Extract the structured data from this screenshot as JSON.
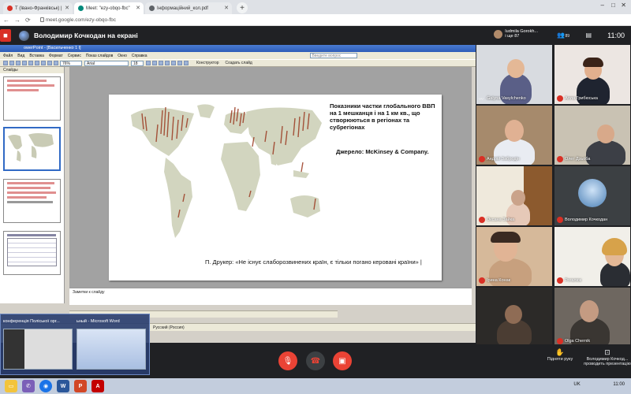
{
  "browser": {
    "tabs": [
      {
        "label": "T (Івано-Франківськ) |",
        "color": "#d93025"
      },
      {
        "label": "Meet: \"ezy-obqo-fbc\"",
        "color": "#00897b"
      },
      {
        "label": "Інформаційний_кол.pdf",
        "color": "#5f6368"
      }
    ],
    "new_tab": "+",
    "url": "meet.google.com/ezy-obqo-fbc",
    "window_controls": [
      "–",
      "□",
      "✕"
    ]
  },
  "meet": {
    "presenting_label": "Володимир Кочкодан на екрані",
    "host_chip_name": "ludmila Gorokh...",
    "host_chip_sub": "і ще 87",
    "people_count": "89",
    "clock": "11:00",
    "participants": [
      {
        "name": "Galyna Vasylchenko",
        "muted": false
      },
      {
        "name": "Алла Грибюська",
        "muted": true
      },
      {
        "name": "Андрій Забродін",
        "muted": true
      },
      {
        "name": "Олег Дзьоба",
        "muted": true
      },
      {
        "name": "Оксана Зайка",
        "muted": true
      },
      {
        "name": "Володимир Кочкодан",
        "muted": true
      },
      {
        "name": "Ірина Конак",
        "muted": true
      },
      {
        "name": "Рогалюк",
        "muted": true
      },
      {
        "name": "",
        "muted": false
      },
      {
        "name": "Olga Chernik",
        "muted": true
      }
    ],
    "controls": {
      "mic_icon": "mic-off",
      "hangup_icon": "hangup",
      "camera_icon": "camera-off",
      "raise_hand": "Підняти руку",
      "presenter_line1": "Володимир Кочкод...",
      "presenter_line2": "проводить презентацію"
    }
  },
  "powerpoint": {
    "title": "owerPoint - [Васильченко 1 l]",
    "menu": [
      "Файл",
      "Вид",
      "Вставка",
      "Формат",
      "Сервис",
      "Показ слайдов",
      "Окно",
      "Справка"
    ],
    "zoom": "76%",
    "font": "Arial",
    "font_size": "18",
    "design_btn": "Конструктор",
    "create_slide_btn": "Создать слайд",
    "search_placeholder": "Введите вопрос",
    "slides_panel_label": "Слайды",
    "notes_placeholder": "Заметки к слайду",
    "status_text": "Русский (Россия)",
    "slide": {
      "title": "Показники частки глобального ВВП на 1 мешканця і на 1 км кв., що створюються в регіонах та субрегіонах",
      "source": "Джерело: McKinsey & Company.",
      "quote": "П. Друкер: «Не існує слаборозвинених країн, є тільки погано керовані країни» |"
    }
  },
  "taskbar_preview": {
    "item1": "конференція Поліської орг...",
    "item2": "ьный - Microsoft Word"
  },
  "taskbar": {
    "tray_lang": "UK",
    "tray_date": "11:00"
  }
}
